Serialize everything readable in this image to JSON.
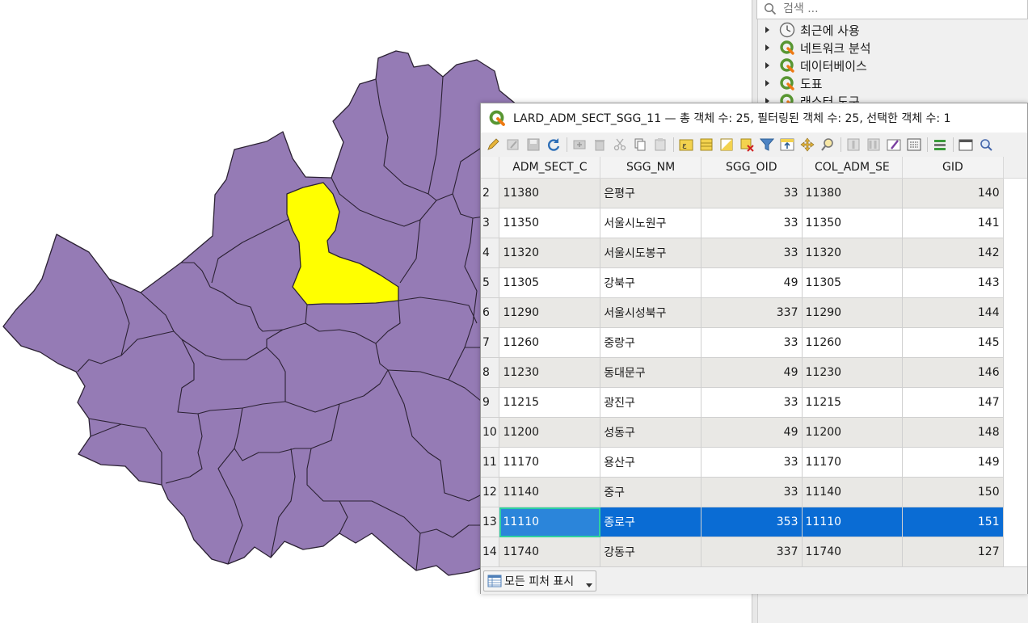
{
  "colors": {
    "polygon_fill": "#957bb5",
    "polygon_stroke": "#2b2133",
    "selected_fill": "#ffff00",
    "row_selected": "#0a6cd4",
    "focus_outline": "#2fd1a0"
  },
  "toolbox": {
    "search_placeholder": "검색 ...",
    "items": [
      {
        "label": "최근에 사용",
        "icon": "clock-icon"
      },
      {
        "label": "네트워크 분석",
        "icon": "qgis-icon"
      },
      {
        "label": "데이터베이스",
        "icon": "qgis-icon"
      },
      {
        "label": "도표",
        "icon": "qgis-icon"
      },
      {
        "label": "래스터 도구",
        "icon": "qgis-icon"
      }
    ]
  },
  "attribute_table": {
    "title": "LARD_ADM_SECT_SGG_11 — 총 객체 수: 25, 필터링된 객체 수: 25, 선택한 객체 수: 1",
    "columns": [
      "ADM_SECT_C",
      "SGG_NM",
      "SGG_OID",
      "COL_ADM_SE",
      "GID"
    ],
    "rows": [
      {
        "n": "2",
        "c": [
          "11380",
          "은평구",
          "33",
          "11380",
          "140"
        ]
      },
      {
        "n": "3",
        "c": [
          "11350",
          "서울시노원구",
          "33",
          "11350",
          "141"
        ]
      },
      {
        "n": "4",
        "c": [
          "11320",
          "서울시도봉구",
          "33",
          "11320",
          "142"
        ]
      },
      {
        "n": "5",
        "c": [
          "11305",
          "강북구",
          "49",
          "11305",
          "143"
        ]
      },
      {
        "n": "6",
        "c": [
          "11290",
          "서울시성북구",
          "337",
          "11290",
          "144"
        ]
      },
      {
        "n": "7",
        "c": [
          "11260",
          "중랑구",
          "33",
          "11260",
          "145"
        ]
      },
      {
        "n": "8",
        "c": [
          "11230",
          "동대문구",
          "49",
          "11230",
          "146"
        ]
      },
      {
        "n": "9",
        "c": [
          "11215",
          "광진구",
          "33",
          "11215",
          "147"
        ]
      },
      {
        "n": "10",
        "c": [
          "11200",
          "성동구",
          "49",
          "11200",
          "148"
        ]
      },
      {
        "n": "11",
        "c": [
          "11170",
          "용산구",
          "33",
          "11170",
          "149"
        ]
      },
      {
        "n": "12",
        "c": [
          "11140",
          "중구",
          "33",
          "11140",
          "150"
        ]
      },
      {
        "n": "13",
        "c": [
          "11110",
          "종로구",
          "353",
          "11110",
          "151"
        ],
        "selected": true
      },
      {
        "n": "14",
        "c": [
          "11740",
          "강동구",
          "337",
          "11740",
          "127"
        ]
      }
    ],
    "show_all_label": "모든 피처 표시"
  }
}
